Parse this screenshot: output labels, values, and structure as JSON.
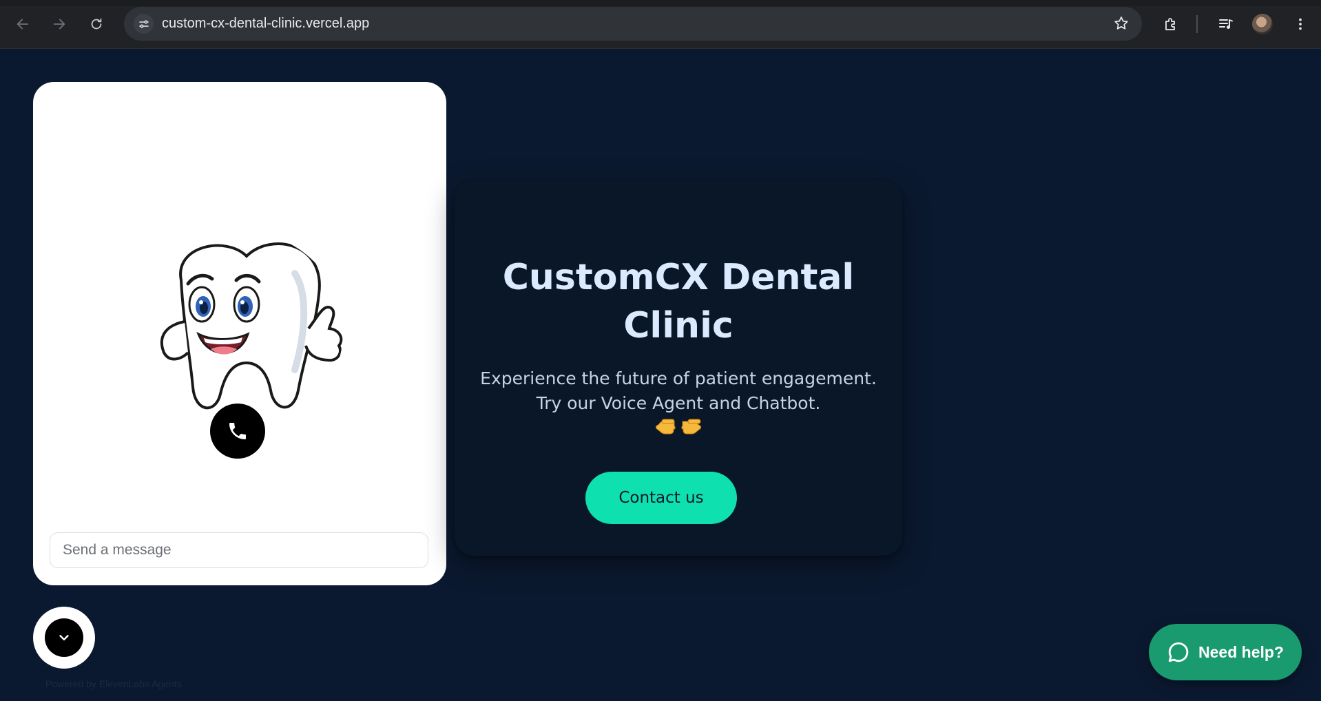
{
  "browser": {
    "url": "custom-cx-dental-clinic.vercel.app"
  },
  "widget": {
    "message_placeholder": "Send a message",
    "powered_by": "Powered by ElevenLabs Agents"
  },
  "hero": {
    "title": "CustomCX Dental Clinic",
    "subtitle_line1": "Experience the future of patient engagement.",
    "subtitle_line2": "Try our Voice Agent and Chatbot.",
    "emoji_left": "👈",
    "emoji_right": "👉",
    "cta_label": "Contact us"
  },
  "help": {
    "label": "Need help?"
  },
  "colors": {
    "page_bg": "#0b1930",
    "accent": "#0fe0b0",
    "help_bg": "#1a9a6f",
    "title": "#dbeafe"
  }
}
